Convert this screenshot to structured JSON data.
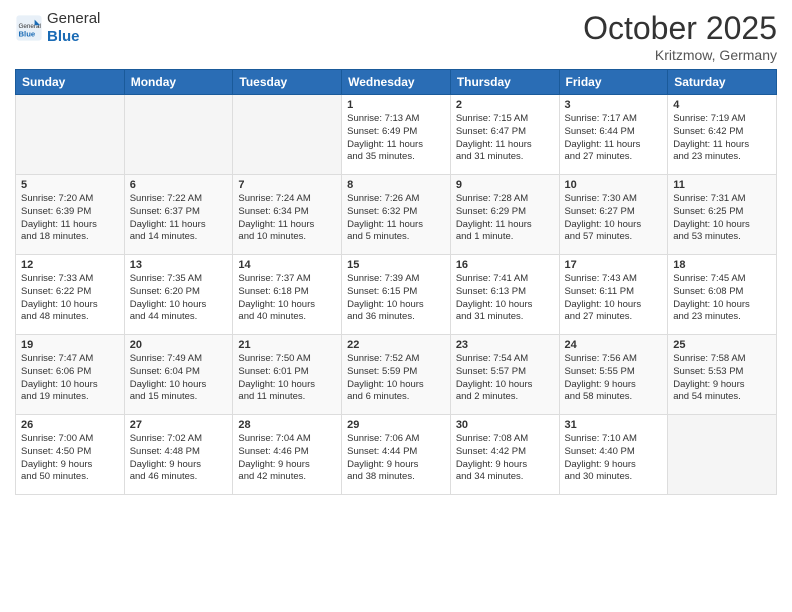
{
  "logo": {
    "general": "General",
    "blue": "Blue"
  },
  "title": "October 2025",
  "location": "Kritzmow, Germany",
  "weekdays": [
    "Sunday",
    "Monday",
    "Tuesday",
    "Wednesday",
    "Thursday",
    "Friday",
    "Saturday"
  ],
  "weeks": [
    [
      {
        "day": "",
        "info": ""
      },
      {
        "day": "",
        "info": ""
      },
      {
        "day": "",
        "info": ""
      },
      {
        "day": "1",
        "info": "Sunrise: 7:13 AM\nSunset: 6:49 PM\nDaylight: 11 hours\nand 35 minutes."
      },
      {
        "day": "2",
        "info": "Sunrise: 7:15 AM\nSunset: 6:47 PM\nDaylight: 11 hours\nand 31 minutes."
      },
      {
        "day": "3",
        "info": "Sunrise: 7:17 AM\nSunset: 6:44 PM\nDaylight: 11 hours\nand 27 minutes."
      },
      {
        "day": "4",
        "info": "Sunrise: 7:19 AM\nSunset: 6:42 PM\nDaylight: 11 hours\nand 23 minutes."
      }
    ],
    [
      {
        "day": "5",
        "info": "Sunrise: 7:20 AM\nSunset: 6:39 PM\nDaylight: 11 hours\nand 18 minutes."
      },
      {
        "day": "6",
        "info": "Sunrise: 7:22 AM\nSunset: 6:37 PM\nDaylight: 11 hours\nand 14 minutes."
      },
      {
        "day": "7",
        "info": "Sunrise: 7:24 AM\nSunset: 6:34 PM\nDaylight: 11 hours\nand 10 minutes."
      },
      {
        "day": "8",
        "info": "Sunrise: 7:26 AM\nSunset: 6:32 PM\nDaylight: 11 hours\nand 5 minutes."
      },
      {
        "day": "9",
        "info": "Sunrise: 7:28 AM\nSunset: 6:29 PM\nDaylight: 11 hours\nand 1 minute."
      },
      {
        "day": "10",
        "info": "Sunrise: 7:30 AM\nSunset: 6:27 PM\nDaylight: 10 hours\nand 57 minutes."
      },
      {
        "day": "11",
        "info": "Sunrise: 7:31 AM\nSunset: 6:25 PM\nDaylight: 10 hours\nand 53 minutes."
      }
    ],
    [
      {
        "day": "12",
        "info": "Sunrise: 7:33 AM\nSunset: 6:22 PM\nDaylight: 10 hours\nand 48 minutes."
      },
      {
        "day": "13",
        "info": "Sunrise: 7:35 AM\nSunset: 6:20 PM\nDaylight: 10 hours\nand 44 minutes."
      },
      {
        "day": "14",
        "info": "Sunrise: 7:37 AM\nSunset: 6:18 PM\nDaylight: 10 hours\nand 40 minutes."
      },
      {
        "day": "15",
        "info": "Sunrise: 7:39 AM\nSunset: 6:15 PM\nDaylight: 10 hours\nand 36 minutes."
      },
      {
        "day": "16",
        "info": "Sunrise: 7:41 AM\nSunset: 6:13 PM\nDaylight: 10 hours\nand 31 minutes."
      },
      {
        "day": "17",
        "info": "Sunrise: 7:43 AM\nSunset: 6:11 PM\nDaylight: 10 hours\nand 27 minutes."
      },
      {
        "day": "18",
        "info": "Sunrise: 7:45 AM\nSunset: 6:08 PM\nDaylight: 10 hours\nand 23 minutes."
      }
    ],
    [
      {
        "day": "19",
        "info": "Sunrise: 7:47 AM\nSunset: 6:06 PM\nDaylight: 10 hours\nand 19 minutes."
      },
      {
        "day": "20",
        "info": "Sunrise: 7:49 AM\nSunset: 6:04 PM\nDaylight: 10 hours\nand 15 minutes."
      },
      {
        "day": "21",
        "info": "Sunrise: 7:50 AM\nSunset: 6:01 PM\nDaylight: 10 hours\nand 11 minutes."
      },
      {
        "day": "22",
        "info": "Sunrise: 7:52 AM\nSunset: 5:59 PM\nDaylight: 10 hours\nand 6 minutes."
      },
      {
        "day": "23",
        "info": "Sunrise: 7:54 AM\nSunset: 5:57 PM\nDaylight: 10 hours\nand 2 minutes."
      },
      {
        "day": "24",
        "info": "Sunrise: 7:56 AM\nSunset: 5:55 PM\nDaylight: 9 hours\nand 58 minutes."
      },
      {
        "day": "25",
        "info": "Sunrise: 7:58 AM\nSunset: 5:53 PM\nDaylight: 9 hours\nand 54 minutes."
      }
    ],
    [
      {
        "day": "26",
        "info": "Sunrise: 7:00 AM\nSunset: 4:50 PM\nDaylight: 9 hours\nand 50 minutes."
      },
      {
        "day": "27",
        "info": "Sunrise: 7:02 AM\nSunset: 4:48 PM\nDaylight: 9 hours\nand 46 minutes."
      },
      {
        "day": "28",
        "info": "Sunrise: 7:04 AM\nSunset: 4:46 PM\nDaylight: 9 hours\nand 42 minutes."
      },
      {
        "day": "29",
        "info": "Sunrise: 7:06 AM\nSunset: 4:44 PM\nDaylight: 9 hours\nand 38 minutes."
      },
      {
        "day": "30",
        "info": "Sunrise: 7:08 AM\nSunset: 4:42 PM\nDaylight: 9 hours\nand 34 minutes."
      },
      {
        "day": "31",
        "info": "Sunrise: 7:10 AM\nSunset: 4:40 PM\nDaylight: 9 hours\nand 30 minutes."
      },
      {
        "day": "",
        "info": ""
      }
    ]
  ]
}
